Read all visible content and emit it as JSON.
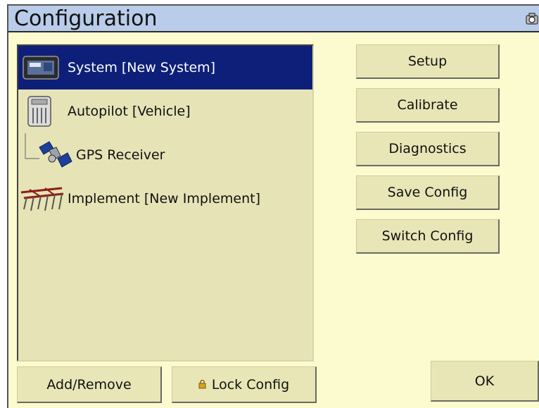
{
  "window": {
    "title": "Configuration",
    "camera_icon": "camera-icon"
  },
  "tree": {
    "items": [
      {
        "label": "System [New System]",
        "icon": "display-unit-icon",
        "selected": true
      },
      {
        "label": "Autopilot [Vehicle]",
        "icon": "controller-module-icon",
        "selected": false
      },
      {
        "label": "GPS Receiver",
        "icon": "satellite-icon",
        "selected": false
      },
      {
        "label": "Implement [New Implement]",
        "icon": "tillage-implement-icon",
        "selected": false
      }
    ]
  },
  "actions": {
    "setup": "Setup",
    "calibrate": "Calibrate",
    "diagnostics": "Diagnostics",
    "save_config": "Save Config",
    "switch_config": "Switch Config"
  },
  "footer": {
    "add_remove": "Add/Remove",
    "lock_config": "Lock Config",
    "ok": "OK"
  },
  "colors": {
    "selection": "#0e1f7a",
    "background": "#fbfbcf",
    "titlebar": "#b9cdea"
  }
}
